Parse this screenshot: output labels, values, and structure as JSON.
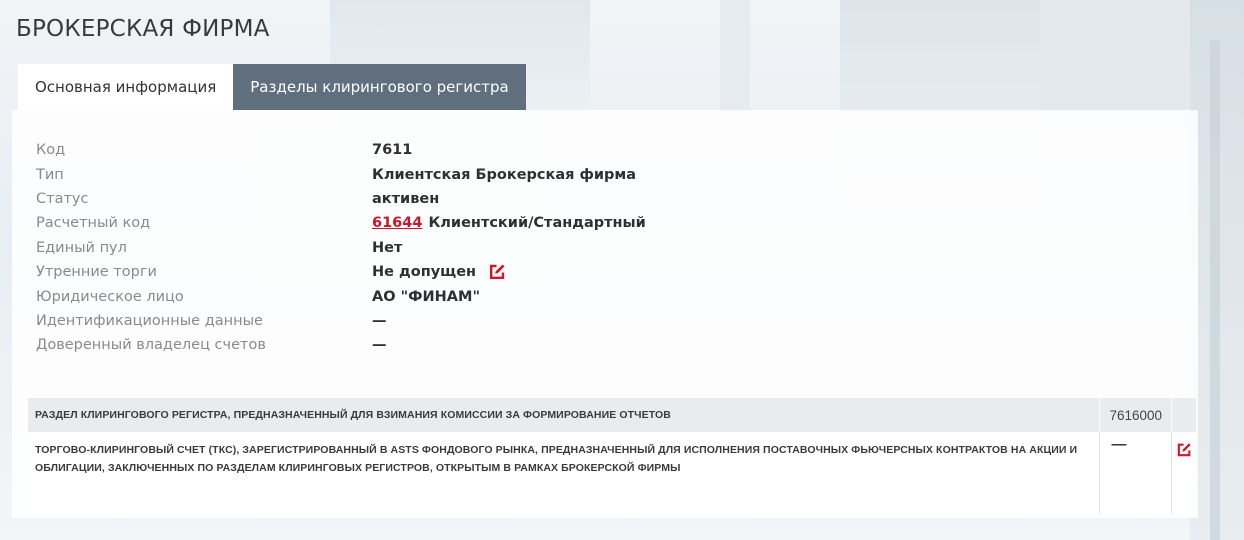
{
  "page": {
    "title": "БРОКЕРСКАЯ ФИРМА"
  },
  "tabs": [
    {
      "label": "Основная информация",
      "active": true
    },
    {
      "label": "Разделы клирингового регистра",
      "active": false
    }
  ],
  "info": {
    "code": {
      "label": "Код",
      "value": "7611"
    },
    "type": {
      "label": "Тип",
      "value": "Клиентская Брокерская фирма"
    },
    "status": {
      "label": "Статус",
      "value": "активен"
    },
    "settlement_code": {
      "label": "Расчетный код",
      "link": "61644",
      "value": "Клиентский/Стандартный"
    },
    "single_pool": {
      "label": "Единый пул",
      "value": "Нет"
    },
    "morning_trading": {
      "label": "Утренние торги",
      "value": "Не допущен",
      "edit_icon": "edit-icon"
    },
    "legal_entity": {
      "label": "Юридическое лицо",
      "value": "АО \"ФИНАМ\""
    },
    "identification": {
      "label": "Идентификационные данные",
      "value": "—"
    },
    "trustee": {
      "label": "Доверенный владелец счетов",
      "value": "—"
    }
  },
  "clearing_table": {
    "header": {
      "description": "РАЗДЕЛ КЛИРИНГОВОГО РЕГИСТРА, ПРЕДНАЗНАЧЕННЫЙ ДЛЯ ВЗИМАНИЯ КОМИССИИ ЗА ФОРМИРОВАНИЕ ОТЧЕТОВ",
      "code": "7616000"
    },
    "rows": [
      {
        "description": "ТОРГОВО-КЛИРИНГОВЫЙ СЧЕТ (ТКС), ЗАРЕГИСТРИРОВАННЫЙ В ASTS ФОНДОВОГО РЫНКА, ПРЕДНАЗНАЧЕННЫЙ ДЛЯ ИСПОЛНЕНИЯ ПОСТАВОЧНЫХ ФЬЮЧЕРСНЫХ КОНТРАКТОВ НА АКЦИИ И ОБЛИГАЦИИ, ЗАКЛЮЧЕННЫХ ПО РАЗДЕЛАМ КЛИРИНГОВЫХ РЕГИСТРОВ, ОТКРЫТЫМ В РАМКАХ БРОКЕРСКОЙ ФИРМЫ",
        "value": "—",
        "edit_icon": "edit-icon"
      }
    ]
  },
  "colors": {
    "accent": "#c7172b",
    "tab_inactive_bg": "#5f6f7e",
    "label_text": "#8a8a8a"
  }
}
